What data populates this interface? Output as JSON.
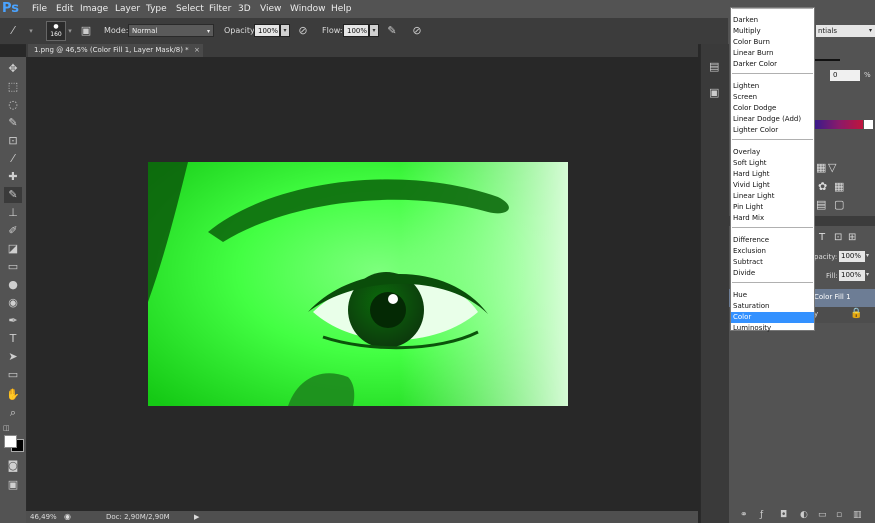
{
  "app": {
    "logo": "Ps"
  },
  "menubar": {
    "items": [
      "File",
      "Edit",
      "Image",
      "Layer",
      "Type",
      "Select",
      "Filter",
      "3D",
      "View",
      "Window",
      "Help"
    ]
  },
  "options": {
    "brush_size": "160",
    "mode_label": "Mode:",
    "mode_value": "Normal",
    "opacity_label": "Opacity:",
    "opacity_value": "100%",
    "flow_label": "Flow:",
    "flow_value": "100%"
  },
  "document": {
    "tab_title": "1.png @ 46,5% (Color Fill 1, Layer Mask/8) *",
    "close_glyph": "×"
  },
  "status": {
    "zoom": "46,49%",
    "doc_size": "Doc: 2,90M/2,90M"
  },
  "right_panel": {
    "workspace": "ntials",
    "adjust_value": "0",
    "adjust_unit": "%",
    "layers_opacity_label": "pacity:",
    "layers_opacity_value": "100%",
    "fill_label": "Fill:",
    "fill_value": "100%",
    "layer_name": "Color Fill 1",
    "layer_mask_suffix": "y"
  },
  "blend_modes": {
    "groups": [
      [
        "Darken",
        "Multiply",
        "Color Burn",
        "Linear Burn",
        "Darker Color"
      ],
      [
        "Lighten",
        "Screen",
        "Color Dodge",
        "Linear Dodge (Add)",
        "Lighter Color"
      ],
      [
        "Overlay",
        "Soft Light",
        "Hard Light",
        "Vivid Light",
        "Linear Light",
        "Pin Light",
        "Hard Mix"
      ],
      [
        "Difference",
        "Exclusion",
        "Subtract",
        "Divide"
      ],
      [
        "Hue",
        "Saturation",
        "Color",
        "Luminosity"
      ]
    ],
    "selected": "Color"
  },
  "colors": {
    "accent": "#3391ff",
    "fill_green": "#2dff2d"
  },
  "icons": {
    "toolbar": [
      "move-icon",
      "marquee-icon",
      "lasso-icon",
      "quick-select-icon",
      "crop-icon",
      "eyedropper-icon",
      "healing-icon",
      "brush-icon",
      "stamp-icon",
      "history-brush-icon",
      "eraser-icon",
      "gradient-icon",
      "blur-icon",
      "dodge-icon",
      "pen-icon",
      "type-icon",
      "path-select-icon",
      "rectangle-icon",
      "hand-icon",
      "zoom-icon"
    ]
  }
}
